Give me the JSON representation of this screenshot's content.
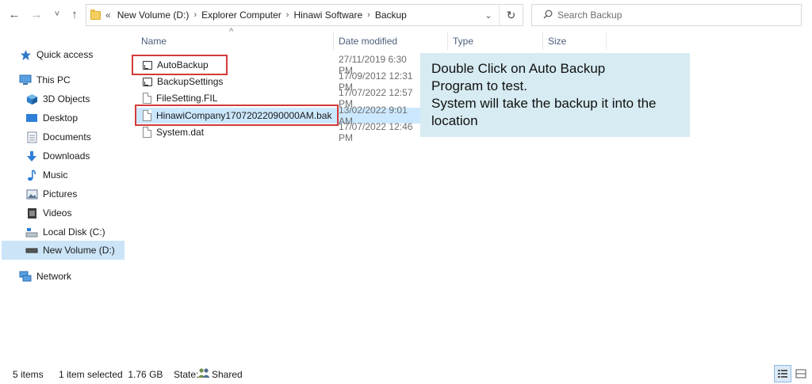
{
  "nav_buttons": {
    "back": "←",
    "forward": "→",
    "recent": "˅",
    "up": "↑"
  },
  "address": {
    "overflow": "«",
    "crumbs": [
      "New Volume (D:)",
      "Explorer Computer",
      "Hinawi Software",
      "Backup"
    ],
    "separator": "›",
    "dropdown": "⌄",
    "refresh": "↻"
  },
  "search": {
    "placeholder": "Search Backup",
    "icon": "search-icon"
  },
  "sidebar": {
    "items": [
      {
        "label": "Quick access",
        "icon": "star-icon"
      },
      {
        "label": "This PC",
        "icon": "computer-icon"
      },
      {
        "label": "3D Objects",
        "icon": "cube-icon"
      },
      {
        "label": "Desktop",
        "icon": "desktop-icon"
      },
      {
        "label": "Documents",
        "icon": "documents-icon"
      },
      {
        "label": "Downloads",
        "icon": "download-icon"
      },
      {
        "label": "Music",
        "icon": "music-icon"
      },
      {
        "label": "Pictures",
        "icon": "pictures-icon"
      },
      {
        "label": "Videos",
        "icon": "videos-icon"
      },
      {
        "label": "Local Disk (C:)",
        "icon": "drive-icon"
      },
      {
        "label": "New Volume (D:)",
        "icon": "drive-icon"
      },
      {
        "label": "Network",
        "icon": "network-icon"
      }
    ],
    "selected": "New Volume (D:)"
  },
  "columns": {
    "sort_indicator": "^",
    "headers": [
      "Name",
      "Date modified",
      "Type",
      "Size"
    ]
  },
  "files": [
    {
      "name": "AutoBackup",
      "date": "27/11/2019 6:30 PM",
      "icon": "shortcut-icon"
    },
    {
      "name": "BackupSettings",
      "date": "17/09/2012 12:31 PM",
      "icon": "shortcut-icon"
    },
    {
      "name": "FileSetting.FIL",
      "date": "17/07/2022 12:57 PM",
      "icon": "file-icon"
    },
    {
      "name": "HinawiCompany17072022090000AM.bak",
      "date": "13/02/2022 9:01 AM",
      "icon": "file-icon",
      "selected": true
    },
    {
      "name": "System.dat",
      "date": "17/07/2022 12:46 PM",
      "icon": "file-icon"
    }
  ],
  "callout": {
    "lines": [
      "Double Click on Auto Backup",
      "Program to test.",
      "System will take the backup it into the",
      "location"
    ]
  },
  "status": {
    "items": "5 items",
    "selection": "1 item selected  1.76 GB",
    "state_label": "State:",
    "state_value": "Shared"
  },
  "colors": {
    "highlight_box": "#d43a3a",
    "callout_bg": "#d6ebf2",
    "selected_row": "#cce8ff",
    "selected_nav": "#cce4f7"
  }
}
